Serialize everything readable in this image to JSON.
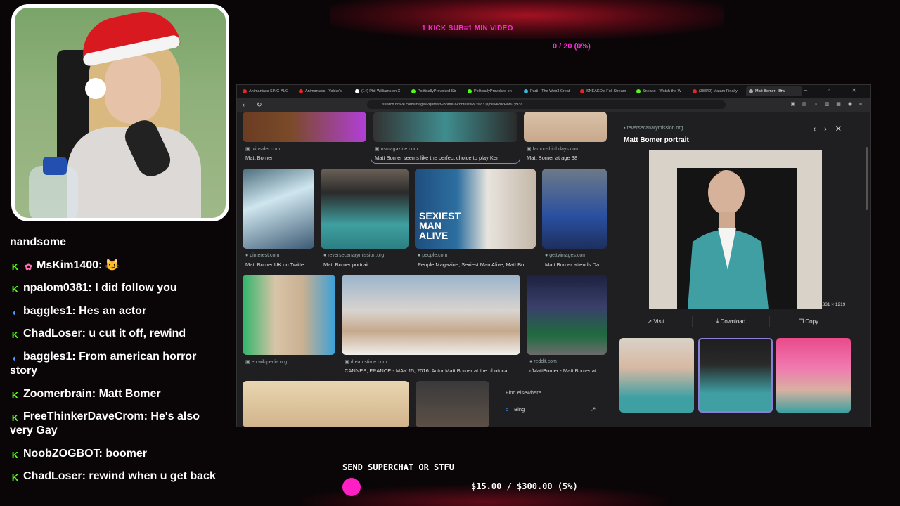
{
  "overlay": {
    "sub_goal_label": "1 KICK SUB=1 MIN VIDEO",
    "sub_goal_count": "0 / 20 (0%)",
    "superchat_label": "SEND SUPERCHAT OR STFU",
    "superchat_progress": "$15.00 / $300.00 (5%)",
    "superchat_fraction": 0.05,
    "accent_color": "#ff1fc4"
  },
  "chat": {
    "messages": [
      {
        "user": "",
        "text": "nandsome",
        "badge": ""
      },
      {
        "user": "MsKim1400",
        "text": "😼",
        "badge": "kick"
      },
      {
        "user": "npalom0381",
        "text": "I did follow you",
        "badge": "kick"
      },
      {
        "user": "baggles1",
        "text": "Hes an actor",
        "badge": "moon"
      },
      {
        "user": "ChadLoser",
        "text": "u cut it off, rewind",
        "badge": "kick"
      },
      {
        "user": "baggles1",
        "text": "From american horror story",
        "badge": "moon"
      },
      {
        "user": "Zoomerbrain",
        "text": "Matt Bomer",
        "badge": "kick"
      },
      {
        "user": "FreeThinkerDaveCrom",
        "text": "He's also very Gay",
        "badge": "kick"
      },
      {
        "user": "NoobZOGBOT",
        "text": "boomer",
        "badge": "kick"
      },
      {
        "user": "ChadLoser",
        "text": "rewind when u get back",
        "badge": "kick"
      }
    ]
  },
  "browser": {
    "tabs": [
      {
        "label": "Animaniacs SING-ALO",
        "color": "#e22"
      },
      {
        "label": "Animaniacs - Yakko's",
        "color": "#e22"
      },
      {
        "label": "(14) Phil Williams on X",
        "color": "#fff"
      },
      {
        "label": "PoliticallyProvoked Str",
        "color": "#53fc18"
      },
      {
        "label": "PoliticallyProvoked on",
        "color": "#53fc18"
      },
      {
        "label": "Parti - The Web3 Creat",
        "color": "#3bd"
      },
      {
        "label": "SNEAKO's Full Stream",
        "color": "#e22"
      },
      {
        "label": "Sneako - Watch the W",
        "color": "#53fc18"
      },
      {
        "label": "(38349) Matam Finally",
        "color": "#e22"
      },
      {
        "label": "Matt Bomer - Bra",
        "color": "#aaa"
      }
    ],
    "url": "search.brave.com/images?q=Matt+Bomer&context=W3sic3JjIjoiaHR0cHM6Ly93a...",
    "results": [
      {
        "source": "tvinsider.com",
        "caption": "Matt Bomer"
      },
      {
        "source": "usmagazine.com",
        "caption": "Matt Bomer seems like the perfect choice to play Ken"
      },
      {
        "source": "famousbirthdays.com",
        "caption": "Matt Bomer at age 38"
      },
      {
        "source": "pinterest.com",
        "caption": "Matt Bomer UK on Twitte..."
      },
      {
        "source": "reversecanarymission.org",
        "caption": "Matt Bomer portrait"
      },
      {
        "source": "people.com",
        "caption": "People Magazine, Sexiest Man Alive, Matt Bo..."
      },
      {
        "source": "gettyimages.com",
        "caption": "Matt Bomer attends Da..."
      },
      {
        "source": "en.wikipedia.org",
        "caption": ""
      },
      {
        "source": "dreamstime.com",
        "caption": "CANNES, FRANCE - MAY 15, 2016: Actor Matt Bomer at the photocal..."
      },
      {
        "source": "reddit.com",
        "caption": "r/MattBomer - Matt Bomer at..."
      }
    ],
    "panel": {
      "source": "reversecanarymission.org",
      "title": "Matt Bomer portrait",
      "dimensions": "1331 × 1219",
      "visit": "Visit",
      "download": "Download",
      "copy": "Copy",
      "find_elsewhere": "Find elsewhere",
      "bing": "Bing"
    },
    "magazine_text": "SEXIEST MAN ALIVE"
  }
}
